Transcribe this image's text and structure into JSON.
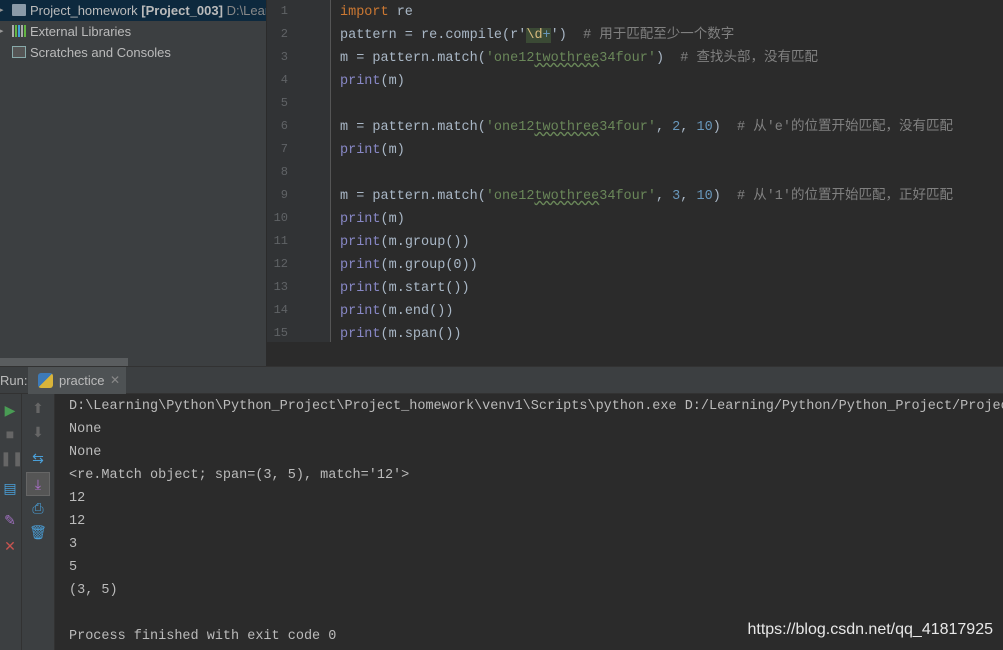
{
  "sidebar": {
    "project": {
      "name": "Project_homework",
      "module": "[Project_003]",
      "path": "D:\\Lear"
    },
    "items": [
      {
        "label": "External Libraries"
      },
      {
        "label": "Scratches and Consoles"
      }
    ]
  },
  "editor": {
    "line_numbers": [
      "1",
      "2",
      "3",
      "4",
      "5",
      "6",
      "7",
      "8",
      "9",
      "10",
      "11",
      "12",
      "13",
      "14",
      "15"
    ],
    "lines": [
      [
        {
          "t": "import",
          "c": "kw"
        },
        {
          "t": " re"
        }
      ],
      [
        {
          "t": "pattern = re.compile(r'"
        },
        {
          "t": "\\d",
          "c": "esc"
        },
        {
          "t": "+",
          "c": "escp"
        },
        {
          "t": "')  "
        },
        {
          "t": "# 用于匹配至少一个数字",
          "c": "cm"
        }
      ],
      [
        {
          "t": "m = pattern.match("
        },
        {
          "t": "'one12",
          "c": "str"
        },
        {
          "t": "twothree",
          "c": "str typo"
        },
        {
          "t": "34four'",
          "c": "str"
        },
        {
          "t": ")  "
        },
        {
          "t": "# 查找头部，没有匹配",
          "c": "cm"
        }
      ],
      [
        {
          "t": "print",
          "c": "bi"
        },
        {
          "t": "(m)"
        }
      ],
      [],
      [
        {
          "t": "m = pattern.match("
        },
        {
          "t": "'one12",
          "c": "str"
        },
        {
          "t": "twothree",
          "c": "str typo"
        },
        {
          "t": "34four'",
          "c": "str"
        },
        {
          "t": ", "
        },
        {
          "t": "2",
          "c": "num"
        },
        {
          "t": ", "
        },
        {
          "t": "10",
          "c": "num"
        },
        {
          "t": ")  "
        },
        {
          "t": "# 从'e'的位置开始匹配，没有匹配",
          "c": "cm"
        }
      ],
      [
        {
          "t": "print",
          "c": "bi"
        },
        {
          "t": "(m)"
        }
      ],
      [],
      [
        {
          "t": "m = pattern.match("
        },
        {
          "t": "'one12",
          "c": "str"
        },
        {
          "t": "twothree",
          "c": "str typo"
        },
        {
          "t": "34four'",
          "c": "str"
        },
        {
          "t": ", "
        },
        {
          "t": "3",
          "c": "num"
        },
        {
          "t": ", "
        },
        {
          "t": "10",
          "c": "num"
        },
        {
          "t": ")  "
        },
        {
          "t": "# 从'1'的位置开始匹配，正好匹配",
          "c": "cm"
        }
      ],
      [
        {
          "t": "print",
          "c": "bi"
        },
        {
          "t": "(m)"
        }
      ],
      [
        {
          "t": "print",
          "c": "bi"
        },
        {
          "t": "(m.group())"
        }
      ],
      [
        {
          "t": "print",
          "c": "bi"
        },
        {
          "t": "(m.group(0))"
        }
      ],
      [
        {
          "t": "print",
          "c": "bi"
        },
        {
          "t": "(m.start())"
        }
      ],
      [
        {
          "t": "print",
          "c": "bi"
        },
        {
          "t": "(m.end())"
        }
      ],
      [
        {
          "t": "print",
          "c": "bi"
        },
        {
          "t": "(m.span())"
        }
      ]
    ]
  },
  "run": {
    "label": "Run:",
    "tab": "practice",
    "tab_icon": "python-icon"
  },
  "console": {
    "lines": [
      "D:\\Learning\\Python\\Python_Project\\Project_homework\\venv1\\Scripts\\python.exe D:/Learning/Python/Python_Project/Project",
      "None",
      "None",
      "<re.Match object; span=(3, 5), match='12'>",
      "12",
      "12",
      "3",
      "5",
      "(3, 5)",
      "",
      "Process finished with exit code 0"
    ]
  },
  "watermark": "https://blog.csdn.net/qq_41817925",
  "colors": {
    "keyword": "#cc7832",
    "string": "#6a8759",
    "number": "#6897bb",
    "builtin": "#8888c6",
    "comment": "#808080",
    "run_green": "#499c54",
    "stop_red": "#c75450"
  }
}
